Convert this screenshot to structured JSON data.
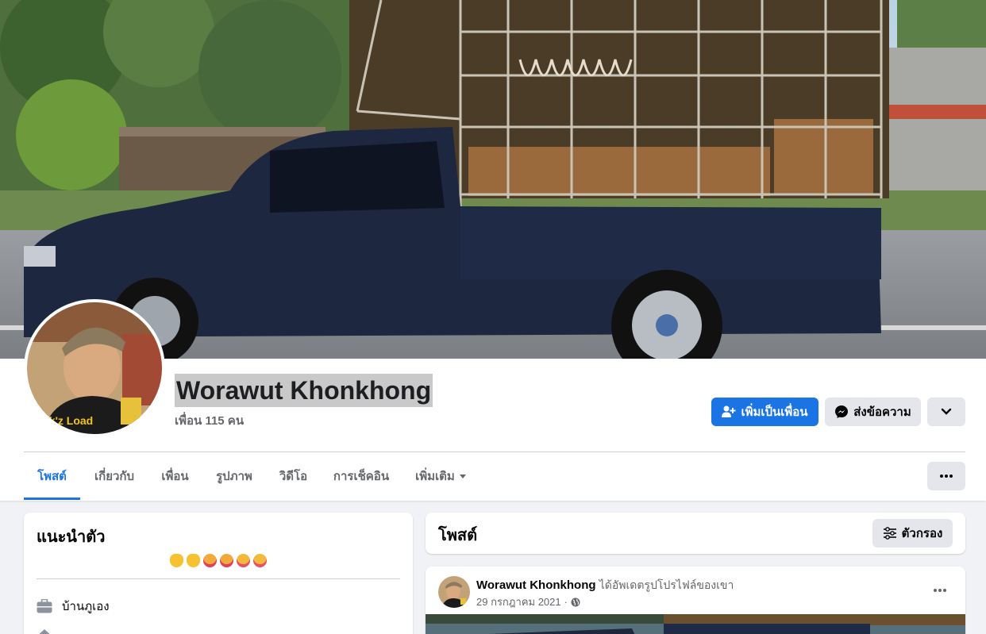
{
  "profile": {
    "name": "Worawut Khonkhong",
    "friends_count": "เพื่อน 115 คน"
  },
  "actions": {
    "add_friend": "เพิ่มเป็นเพื่อน",
    "message": "ส่งข้อความ"
  },
  "tabs": [
    {
      "label": "โพสต์"
    },
    {
      "label": "เกี่ยวกับ"
    },
    {
      "label": "เพื่อน"
    },
    {
      "label": "รูปภาพ"
    },
    {
      "label": "วิดีโอ"
    },
    {
      "label": "การเช็คอิน"
    },
    {
      "label": "เพิ่มเติม"
    }
  ],
  "intro": {
    "title": "แนะนำตัว",
    "hometown": "บ้านภูเอง"
  },
  "posts": {
    "title": "โพสต์",
    "filter": "ตัวกรอง",
    "first": {
      "author": "Worawut Khonkhong",
      "action": "ได้อัพเดตรูปโปรไฟล์ของเขา",
      "date": "29 กรกฎาคม 2021"
    }
  },
  "colors": {
    "accent": "#1b74e4",
    "secondary_bg": "#e4e6eb",
    "page_bg": "#f0f2f5",
    "muted_text": "#65676b"
  }
}
